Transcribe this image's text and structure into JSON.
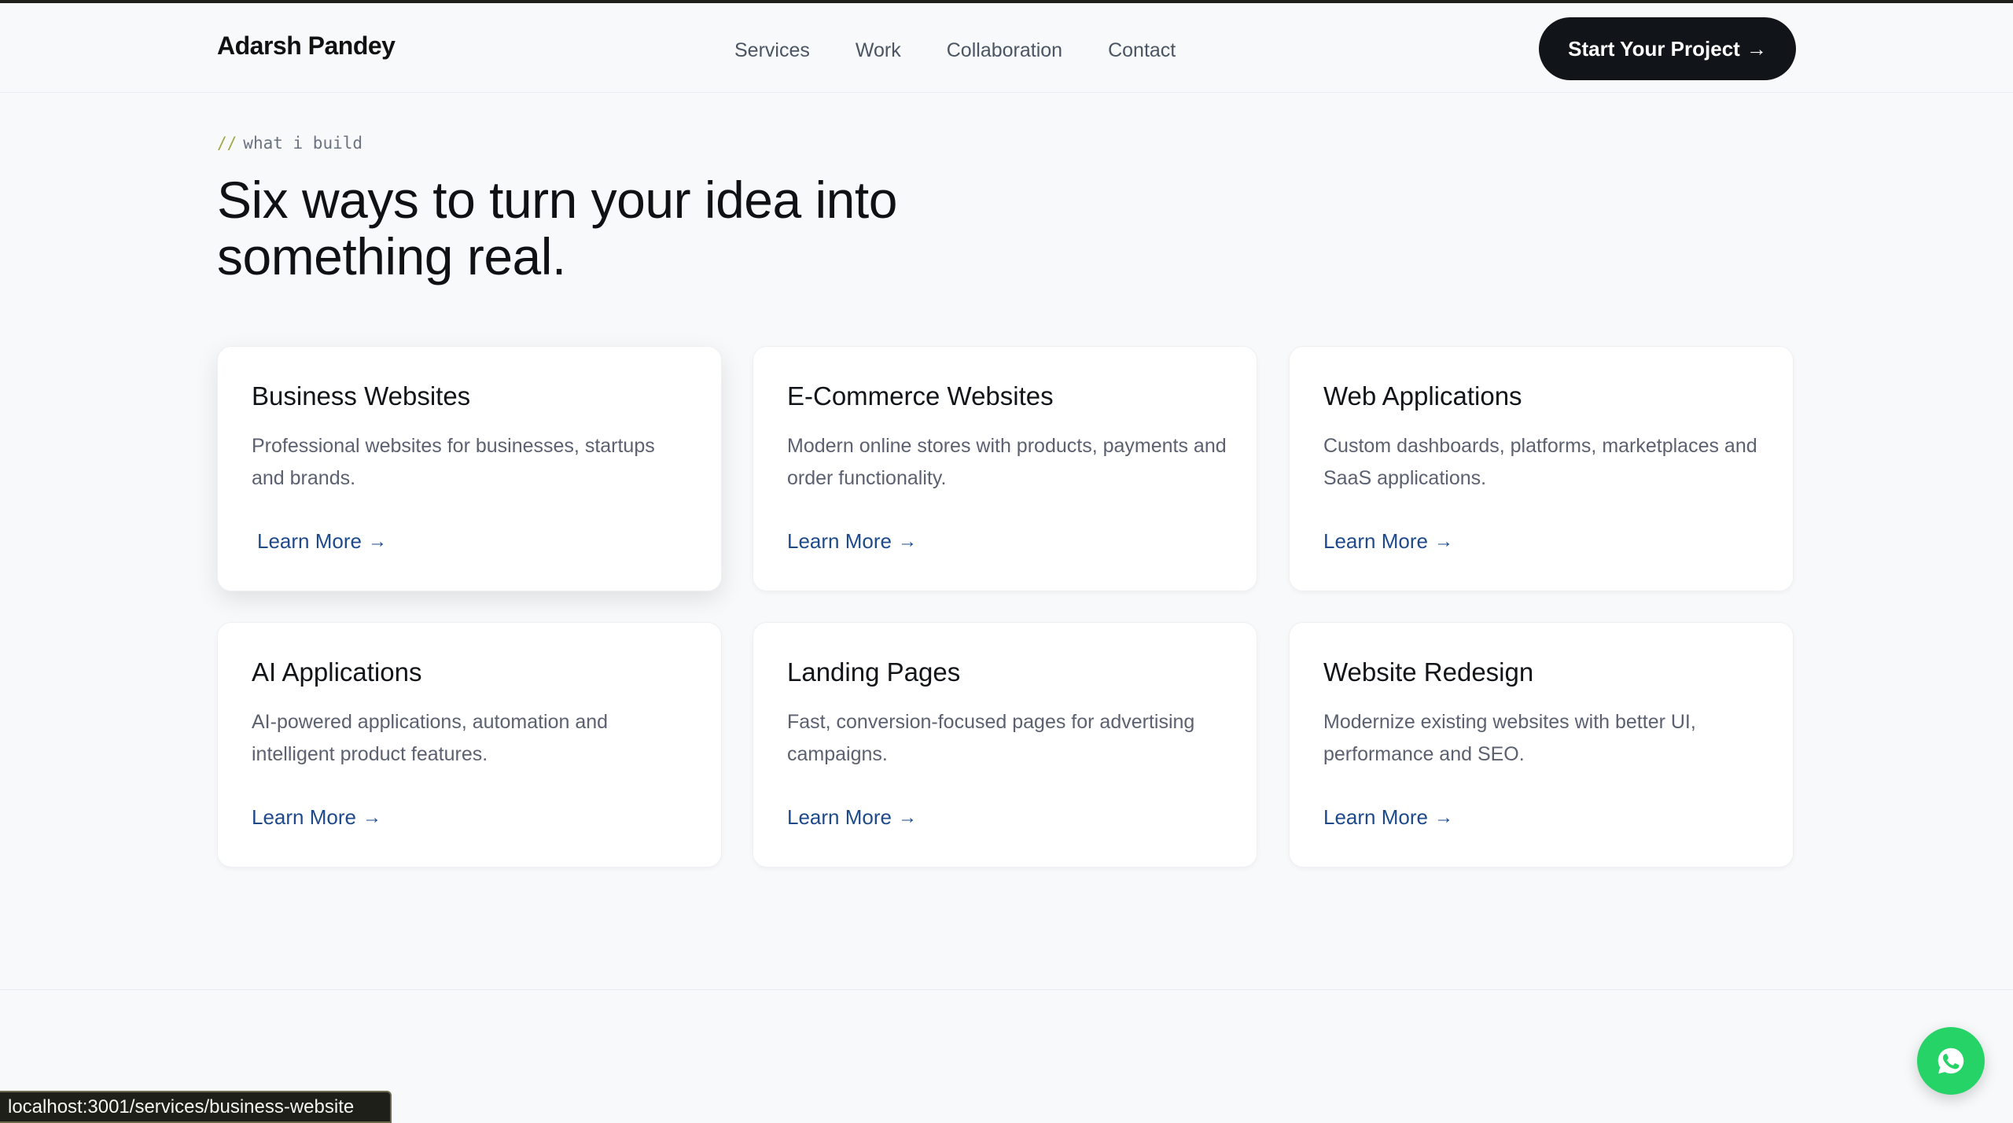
{
  "header": {
    "logo": "Adarsh Pandey",
    "nav": [
      "Services",
      "Work",
      "Collaboration",
      "Contact"
    ],
    "cta_label": "Start Your Project",
    "cta_arrow": "→"
  },
  "section": {
    "eyebrow_slashes": "//",
    "eyebrow": "what i build",
    "headline": "Six ways to turn your idea into something real."
  },
  "cards": [
    {
      "title": "Business Websites",
      "desc": "Professional websites for businesses, startups and brands.",
      "link": "Learn More",
      "arrow": "→"
    },
    {
      "title": "E-Commerce Websites",
      "desc": "Modern online stores with products, payments and order functionality.",
      "link": "Learn More",
      "arrow": "→"
    },
    {
      "title": "Web Applications",
      "desc": "Custom dashboards, platforms, marketplaces and SaaS applications.",
      "link": "Learn More",
      "arrow": "→"
    },
    {
      "title": "AI Applications",
      "desc": "AI-powered applications, automation and intelligent product features.",
      "link": "Learn More",
      "arrow": "→"
    },
    {
      "title": "Landing Pages",
      "desc": "Fast, conversion-focused pages for advertising campaigns.",
      "link": "Learn More",
      "arrow": "→"
    },
    {
      "title": "Website Redesign",
      "desc": "Modernize existing websites with better UI, performance and SEO.",
      "link": "Learn More",
      "arrow": "→"
    }
  ],
  "status_bar": {
    "url": "localhost:3001/services/business-website"
  },
  "floating": {
    "icon": "whatsapp-icon"
  },
  "colors": {
    "background": "#f8f9fa",
    "cta_bg": "#111418",
    "link": "#1e4a8c",
    "whatsapp": "#25d366",
    "eyebrow_slashes": "#a3a848"
  }
}
